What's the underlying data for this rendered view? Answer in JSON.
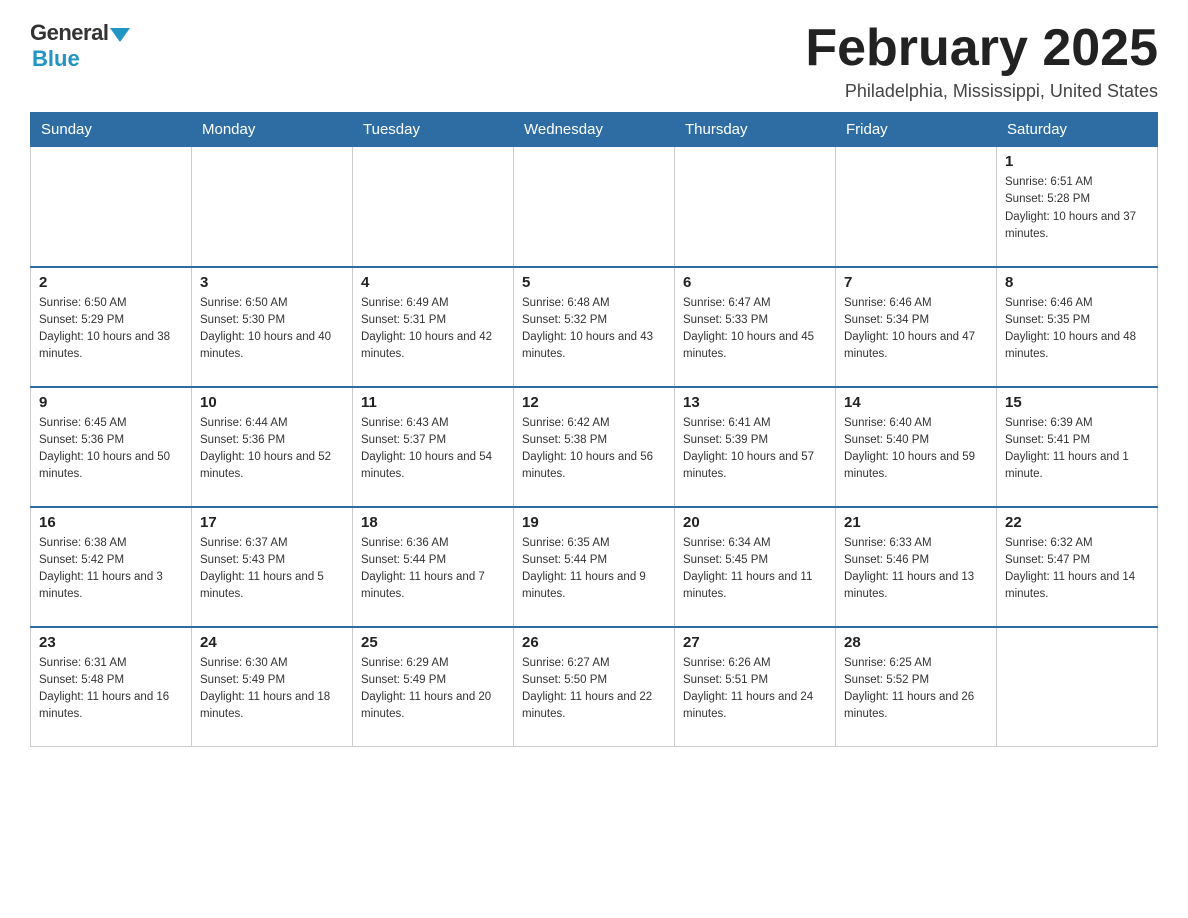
{
  "logo": {
    "general": "General",
    "blue": "Blue"
  },
  "header": {
    "title": "February 2025",
    "location": "Philadelphia, Mississippi, United States"
  },
  "weekdays": [
    "Sunday",
    "Monday",
    "Tuesday",
    "Wednesday",
    "Thursday",
    "Friday",
    "Saturday"
  ],
  "weeks": [
    [
      {
        "day": "",
        "info": ""
      },
      {
        "day": "",
        "info": ""
      },
      {
        "day": "",
        "info": ""
      },
      {
        "day": "",
        "info": ""
      },
      {
        "day": "",
        "info": ""
      },
      {
        "day": "",
        "info": ""
      },
      {
        "day": "1",
        "info": "Sunrise: 6:51 AM\nSunset: 5:28 PM\nDaylight: 10 hours and 37 minutes."
      }
    ],
    [
      {
        "day": "2",
        "info": "Sunrise: 6:50 AM\nSunset: 5:29 PM\nDaylight: 10 hours and 38 minutes."
      },
      {
        "day": "3",
        "info": "Sunrise: 6:50 AM\nSunset: 5:30 PM\nDaylight: 10 hours and 40 minutes."
      },
      {
        "day": "4",
        "info": "Sunrise: 6:49 AM\nSunset: 5:31 PM\nDaylight: 10 hours and 42 minutes."
      },
      {
        "day": "5",
        "info": "Sunrise: 6:48 AM\nSunset: 5:32 PM\nDaylight: 10 hours and 43 minutes."
      },
      {
        "day": "6",
        "info": "Sunrise: 6:47 AM\nSunset: 5:33 PM\nDaylight: 10 hours and 45 minutes."
      },
      {
        "day": "7",
        "info": "Sunrise: 6:46 AM\nSunset: 5:34 PM\nDaylight: 10 hours and 47 minutes."
      },
      {
        "day": "8",
        "info": "Sunrise: 6:46 AM\nSunset: 5:35 PM\nDaylight: 10 hours and 48 minutes."
      }
    ],
    [
      {
        "day": "9",
        "info": "Sunrise: 6:45 AM\nSunset: 5:36 PM\nDaylight: 10 hours and 50 minutes."
      },
      {
        "day": "10",
        "info": "Sunrise: 6:44 AM\nSunset: 5:36 PM\nDaylight: 10 hours and 52 minutes."
      },
      {
        "day": "11",
        "info": "Sunrise: 6:43 AM\nSunset: 5:37 PM\nDaylight: 10 hours and 54 minutes."
      },
      {
        "day": "12",
        "info": "Sunrise: 6:42 AM\nSunset: 5:38 PM\nDaylight: 10 hours and 56 minutes."
      },
      {
        "day": "13",
        "info": "Sunrise: 6:41 AM\nSunset: 5:39 PM\nDaylight: 10 hours and 57 minutes."
      },
      {
        "day": "14",
        "info": "Sunrise: 6:40 AM\nSunset: 5:40 PM\nDaylight: 10 hours and 59 minutes."
      },
      {
        "day": "15",
        "info": "Sunrise: 6:39 AM\nSunset: 5:41 PM\nDaylight: 11 hours and 1 minute."
      }
    ],
    [
      {
        "day": "16",
        "info": "Sunrise: 6:38 AM\nSunset: 5:42 PM\nDaylight: 11 hours and 3 minutes."
      },
      {
        "day": "17",
        "info": "Sunrise: 6:37 AM\nSunset: 5:43 PM\nDaylight: 11 hours and 5 minutes."
      },
      {
        "day": "18",
        "info": "Sunrise: 6:36 AM\nSunset: 5:44 PM\nDaylight: 11 hours and 7 minutes."
      },
      {
        "day": "19",
        "info": "Sunrise: 6:35 AM\nSunset: 5:44 PM\nDaylight: 11 hours and 9 minutes."
      },
      {
        "day": "20",
        "info": "Sunrise: 6:34 AM\nSunset: 5:45 PM\nDaylight: 11 hours and 11 minutes."
      },
      {
        "day": "21",
        "info": "Sunrise: 6:33 AM\nSunset: 5:46 PM\nDaylight: 11 hours and 13 minutes."
      },
      {
        "day": "22",
        "info": "Sunrise: 6:32 AM\nSunset: 5:47 PM\nDaylight: 11 hours and 14 minutes."
      }
    ],
    [
      {
        "day": "23",
        "info": "Sunrise: 6:31 AM\nSunset: 5:48 PM\nDaylight: 11 hours and 16 minutes."
      },
      {
        "day": "24",
        "info": "Sunrise: 6:30 AM\nSunset: 5:49 PM\nDaylight: 11 hours and 18 minutes."
      },
      {
        "day": "25",
        "info": "Sunrise: 6:29 AM\nSunset: 5:49 PM\nDaylight: 11 hours and 20 minutes."
      },
      {
        "day": "26",
        "info": "Sunrise: 6:27 AM\nSunset: 5:50 PM\nDaylight: 11 hours and 22 minutes."
      },
      {
        "day": "27",
        "info": "Sunrise: 6:26 AM\nSunset: 5:51 PM\nDaylight: 11 hours and 24 minutes."
      },
      {
        "day": "28",
        "info": "Sunrise: 6:25 AM\nSunset: 5:52 PM\nDaylight: 11 hours and 26 minutes."
      },
      {
        "day": "",
        "info": ""
      }
    ]
  ]
}
